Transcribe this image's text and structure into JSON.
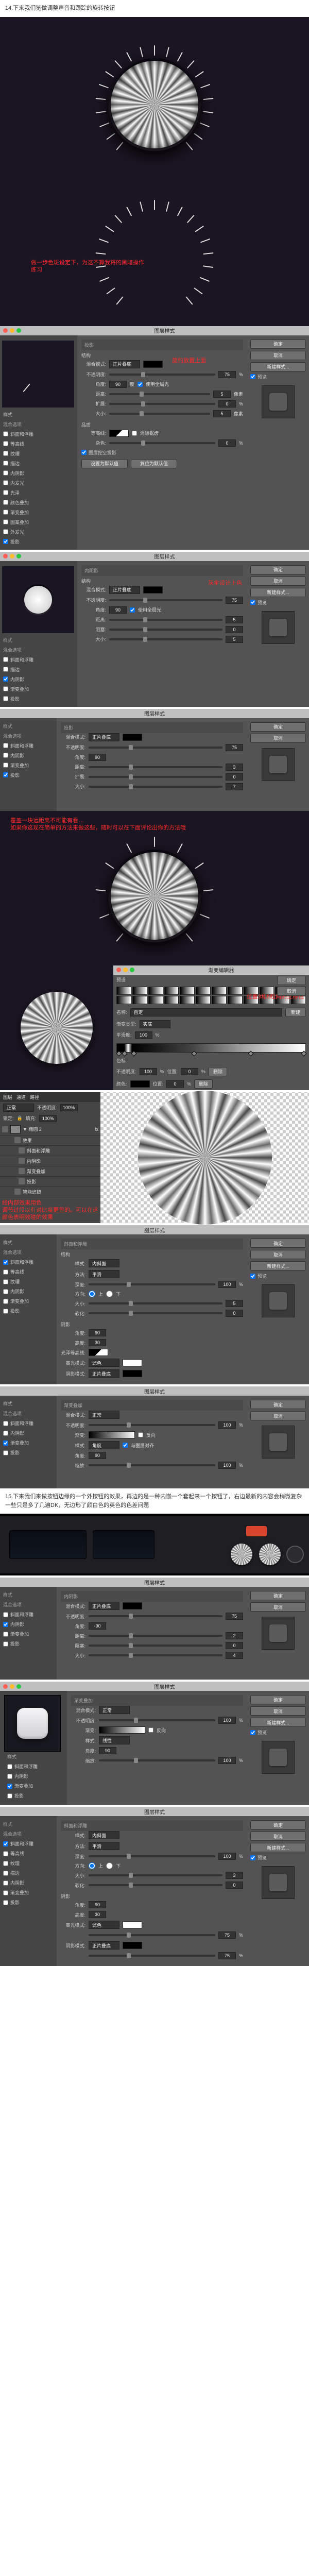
{
  "step14": "14.下来我们览做调整声音和跟踪的旋转按钮",
  "annot1": "做一步色斑设定下，为这不算我将的黑暗操作练习",
  "annot2": "旋约放置上面",
  "annot3": "覆盖一块远距离不可能有看…",
  "annot4": "如果你这现在简单的方法来做这些，随时可以在下面评论出你的方法哦",
  "annot5a": "经内部效果用色",
  "annot5b": "调节过段以有对比度更显的。可以在这颜色表明效碰的效果",
  "annot6": "位置3和8粒间的迁移色",
  "dialog": {
    "title": "图层样式",
    "ok": "确定",
    "cancel": "取消",
    "new": "新建样式...",
    "previewChk": "预览",
    "leftHeader": "样式",
    "leftSub": "混合选项",
    "items": [
      "斜面和浮雕",
      "等高线",
      "纹理",
      "描边",
      "内阴影",
      "内发光",
      "光泽",
      "颜色叠加",
      "渐变叠加",
      "图案叠加",
      "外发光",
      "投影"
    ],
    "shadow": {
      "section": "投影",
      "struct": "结构",
      "blend": "混合模式:",
      "blendVal": "正片叠底",
      "opacity": "不透明度:",
      "opacityVal": "75",
      "angle": "角度:",
      "angleVal": "90",
      "globalLight": "使用全局光",
      "distance": "距离:",
      "distanceVal": "5",
      "spread": "扩展:",
      "spreadVal": "0",
      "size": "大小:",
      "sizeVal": "5",
      "quality": "品质",
      "contour": "等高线:",
      "anti": "消除锯齿",
      "noise": "杂色:",
      "noiseVal": "0",
      "knockout": "图层挖空投影",
      "default": "设置为默认值",
      "reset": "复位为默认值",
      "px": "像素",
      "pct": "%",
      "deg": "度"
    },
    "inner": {
      "section": "内阴影",
      "struct": "结构",
      "blend": "混合模式:",
      "blendVal": "正片叠底",
      "opacity": "不透明度:",
      "angle": "角度:",
      "distance": "距离:",
      "choke": "阻塞:",
      "size": "大小:"
    },
    "gradOverlay": {
      "section": "渐变叠加",
      "grad": "渐变:",
      "blend": "混合模式:",
      "blendVal": "正常",
      "opacity": "不透明度:",
      "opacityVal": "100",
      "reverse": "反向",
      "style": "样式:",
      "styleVal": "角度",
      "align": "与图层对齐",
      "angle": "角度:",
      "angleVal": "90",
      "scale": "缩放:",
      "scaleVal": "100"
    },
    "bevel": {
      "section": "斜面和浮雕",
      "struct": "结构",
      "style": "样式:",
      "styleVal": "内斜面",
      "method": "方法:",
      "methodVal": "平滑",
      "depth": "深度:",
      "depthVal": "100",
      "dir": "方向:",
      "up": "上",
      "down": "下",
      "size": "大小:",
      "soften": "软化:",
      "shade": "阴影",
      "angle": "角度:",
      "alt": "高度:",
      "gloss": "光泽等高线:",
      "hilite": "高光模式:",
      "hiliteVal": "滤色",
      "shadow": "阴影模式:",
      "shadowVal": "正片叠底"
    }
  },
  "gradEditor": {
    "title": "渐变编辑器",
    "presets": "预设",
    "name": "名称:",
    "nameVal": "自定",
    "type": "渐变类型:",
    "typeVal": "实底",
    "smooth": "平滑度:",
    "smoothVal": "100",
    "stops": "色标",
    "opacity": "不透明度:",
    "pos": "位置:",
    "color": "颜色:",
    "del": "删除",
    "new": "新建"
  },
  "layers": {
    "title": "图层",
    "tabs": [
      "图层",
      "通道",
      "路径"
    ],
    "mode": "正常",
    "opacity": "不透明度:",
    "opacityVal": "100%",
    "fill": "填充:",
    "fillVal": "100%",
    "lock": "锁定:",
    "group": "椭圆 2",
    "fx": "效果",
    "fxItems": [
      "斜面和浮雕",
      "内阴影",
      "渐变叠加",
      "投影"
    ],
    "smart": "智能滤镜"
  },
  "step15": "15.下来我们来做按钮边缘的一个外按钮的效果，再边的是一种内嵌一个套起来一个按钮了，右边最新的内容会稍微复杂一些只是多了几遍DK，无边形了颜白色的英色的色差问题"
}
